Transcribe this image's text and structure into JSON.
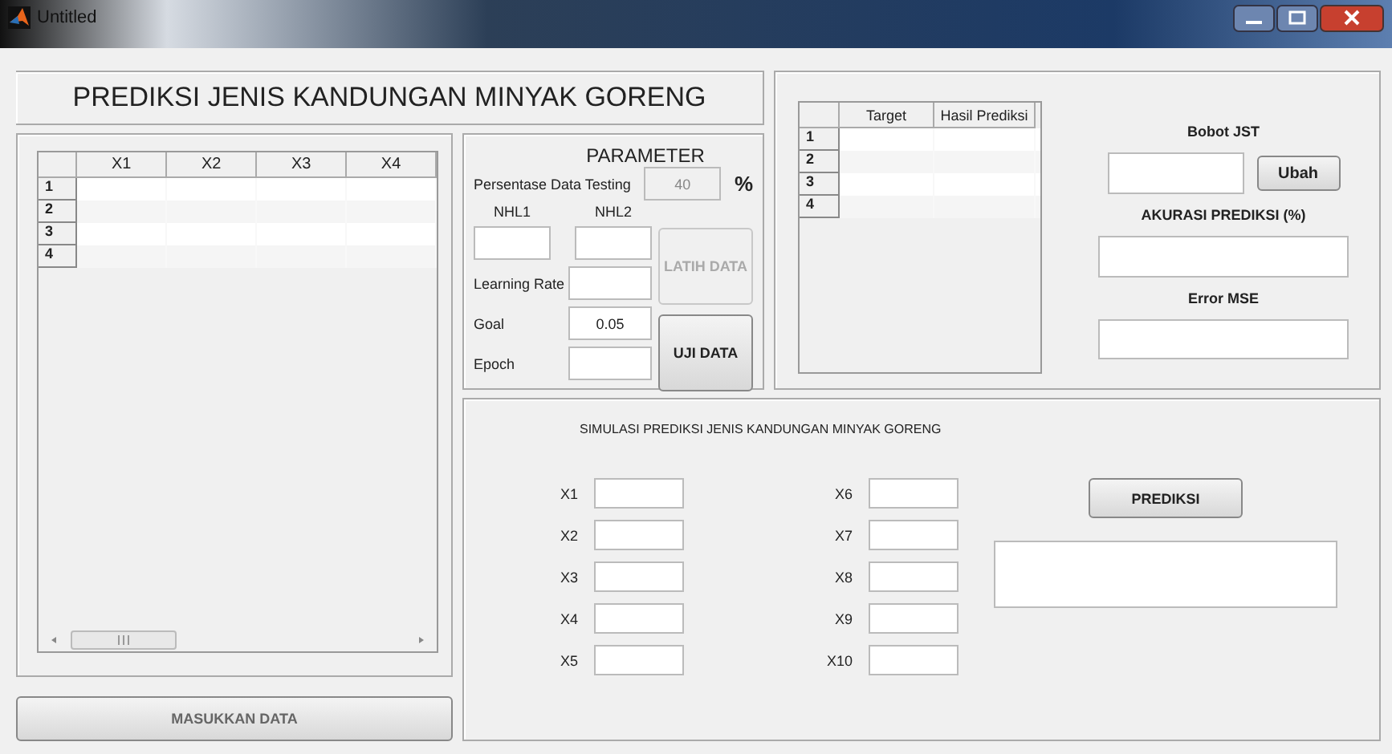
{
  "window": {
    "title": "Untitled"
  },
  "header": {
    "title": "PREDIKSI JENIS KANDUNGAN MINYAK GORENG"
  },
  "data_table": {
    "columns": [
      "X1",
      "X2",
      "X3",
      "X4"
    ],
    "rows": [
      "1",
      "2",
      "3",
      "4"
    ]
  },
  "parameter": {
    "title": "PARAMETER",
    "testing_label": "Persentase Data Testing",
    "testing_value": "40",
    "testing_disabled": true,
    "unit": "%",
    "nhl1_label": "NHL1",
    "nhl2_label": "NHL2",
    "learning_rate_label": "Learning Rate",
    "goal_label": "Goal",
    "goal_value": "0.05",
    "epoch_label": "Epoch",
    "buttons": [
      {
        "label": "LATIH DATA",
        "disabled": true
      },
      {
        "label": "UJI DATA",
        "disabled": false
      }
    ]
  },
  "result_table": {
    "columns": [
      "Target",
      "Hasil Prediksi"
    ],
    "rows": [
      "1",
      "2",
      "3",
      "4"
    ]
  },
  "results": {
    "bobot_label": "Bobot JST",
    "ubah_button": "Ubah",
    "akurasi_label": "AKURASI PREDIKSI (%)",
    "error_label": "Error MSE"
  },
  "simulation": {
    "title": "SIMULASI PREDIKSI JENIS KANDUNGAN MINYAK GORENG",
    "inputs": [
      {
        "label": "X1"
      },
      {
        "label": "X2"
      },
      {
        "label": "X3"
      },
      {
        "label": "X4"
      },
      {
        "label": "X5"
      },
      {
        "label": "X6"
      },
      {
        "label": "X7"
      },
      {
        "label": "X8"
      },
      {
        "label": "X9"
      },
      {
        "label": "X10"
      }
    ],
    "button": "PREDIKSI"
  },
  "input_button": {
    "label": "MASUKKAN DATA"
  }
}
